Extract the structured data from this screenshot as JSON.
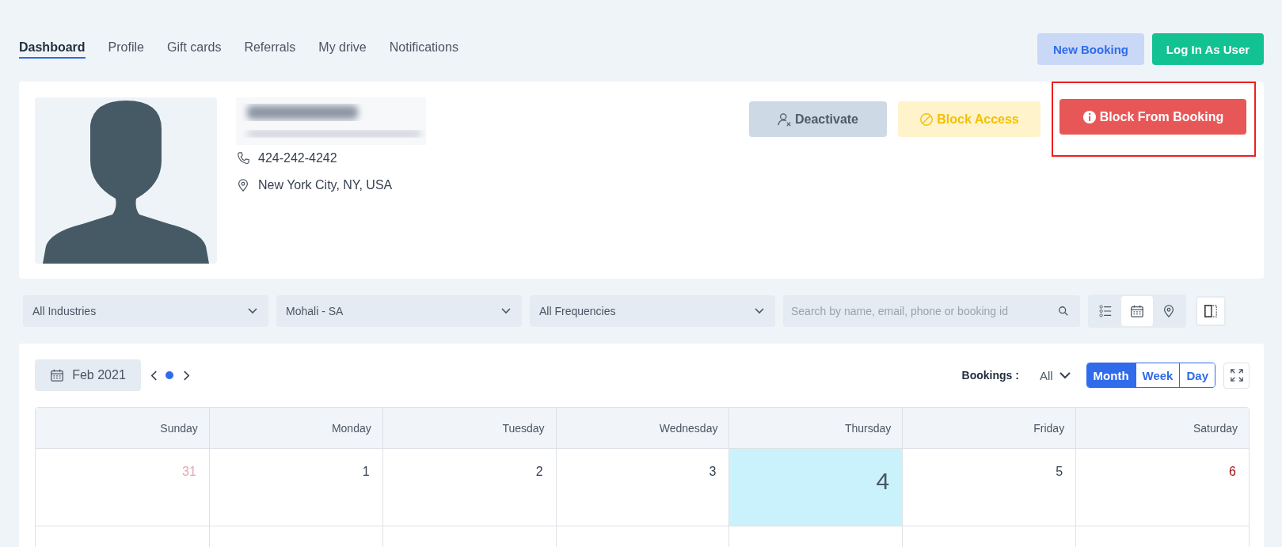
{
  "tabs": [
    {
      "label": "Dashboard",
      "selected": true
    },
    {
      "label": "Profile",
      "selected": false
    },
    {
      "label": "Gift cards",
      "selected": false
    },
    {
      "label": "Referrals",
      "selected": false
    },
    {
      "label": "My drive",
      "selected": false
    },
    {
      "label": "Notifications",
      "selected": false
    }
  ],
  "header_buttons": [
    {
      "label": "New Booking",
      "kind": "secondary"
    },
    {
      "label": "Log In As User",
      "kind": "success"
    }
  ],
  "profile": {
    "phone": "424-242-4242",
    "location": "New York City, NY, USA",
    "actions": [
      {
        "label": "Deactivate",
        "kind": "neutral"
      },
      {
        "label": "Block Access",
        "kind": "warning"
      },
      {
        "label": "Block From Booking",
        "kind": "danger",
        "highlighted": true
      }
    ]
  },
  "filters": [
    {
      "value": "All Industries"
    },
    {
      "value": "Mohali - SA"
    },
    {
      "value": "All Frequencies"
    }
  ],
  "search": {
    "placeholder": "Search by name, email, phone or booking id"
  },
  "view_toggle": [
    {
      "kind": "list",
      "selected": false
    },
    {
      "kind": "calendar",
      "selected": true
    },
    {
      "kind": "map",
      "selected": false
    }
  ],
  "calendar": {
    "month": "Feb 2021",
    "bookings_label": "Bookings :",
    "bookings_filter": "All",
    "views": [
      {
        "label": "Month",
        "selected": true
      },
      {
        "label": "Week",
        "selected": false
      },
      {
        "label": "Day",
        "selected": false
      }
    ],
    "weekdays": [
      "Sunday",
      "Monday",
      "Tuesday",
      "Wednesday",
      "Thursday",
      "Friday",
      "Saturday"
    ],
    "days": [
      {
        "label": "31",
        "kind": "other_month"
      },
      {
        "label": "1",
        "kind": "normal"
      },
      {
        "label": "2",
        "kind": "normal"
      },
      {
        "label": "3",
        "kind": "normal"
      },
      {
        "label": "4",
        "kind": "today"
      },
      {
        "label": "5",
        "kind": "normal"
      },
      {
        "label": "6",
        "kind": "weekend"
      }
    ]
  }
}
